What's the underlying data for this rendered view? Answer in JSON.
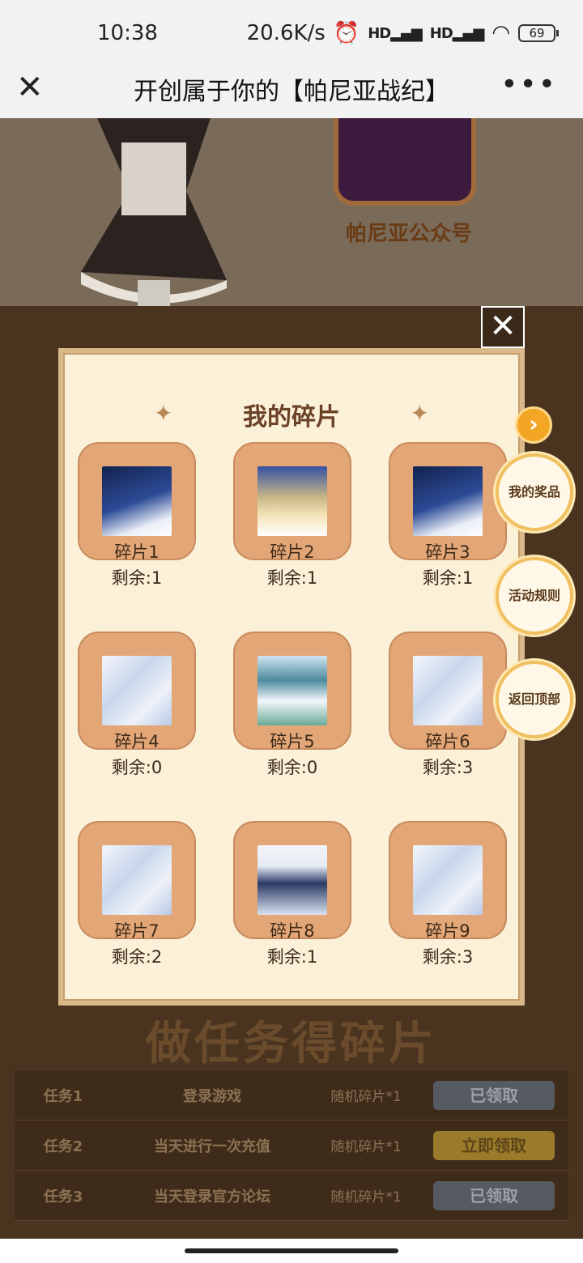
{
  "status_bar": {
    "time": "10:38",
    "network_speed": "20.6K/s",
    "signal_1": "HD",
    "signal_2": "HD",
    "battery": "69"
  },
  "title_bar": {
    "title": "开创属于你的【帕尼亚战纪】",
    "close_icon": "close-icon",
    "more_icon": "more-icon"
  },
  "background": {
    "qr_label": "帕尼亚公众号",
    "heading": "做任务得碎片",
    "tasks": [
      {
        "name": "任务1",
        "desc": "登录游戏",
        "reward": "随机碎片*1",
        "button": "已领取",
        "status": "done"
      },
      {
        "name": "任务2",
        "desc": "当天进行一次充值",
        "reward": "随机碎片*1",
        "button": "立即领取",
        "status": "claim"
      },
      {
        "name": "任务3",
        "desc": "当天登录官方论坛",
        "reward": "随机碎片*1",
        "button": "已领取",
        "status": "done"
      }
    ]
  },
  "modal": {
    "title": "我的碎片",
    "fragments": [
      {
        "name": "碎片1",
        "remaining": "剩余:1"
      },
      {
        "name": "碎片2",
        "remaining": "剩余:1"
      },
      {
        "name": "碎片3",
        "remaining": "剩余:1"
      },
      {
        "name": "碎片4",
        "remaining": "剩余:0"
      },
      {
        "name": "碎片5",
        "remaining": "剩余:0"
      },
      {
        "name": "碎片6",
        "remaining": "剩余:3"
      },
      {
        "name": "碎片7",
        "remaining": "剩余:2"
      },
      {
        "name": "碎片8",
        "remaining": "剩余:1"
      },
      {
        "name": "碎片9",
        "remaining": "剩余:3"
      }
    ]
  },
  "side_menu": {
    "arrow_icon": "chevron-right-icon",
    "my_prizes": "我的奖品",
    "rules": "活动规则",
    "back_to_top": "返回顶部"
  },
  "colors": {
    "accent": "#f2a623",
    "modal_bg": "#fbf0d8",
    "fragment_tile": "#e2a677"
  }
}
